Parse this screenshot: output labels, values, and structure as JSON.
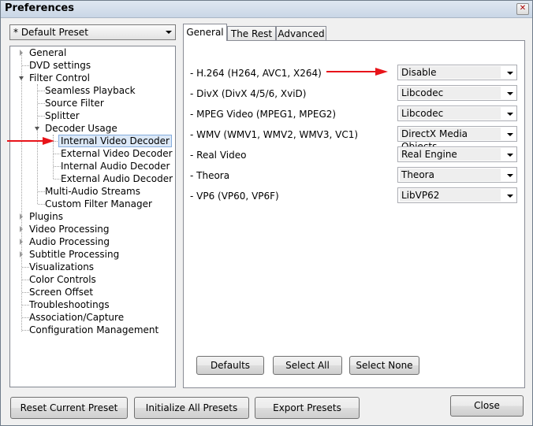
{
  "window": {
    "title": "Preferences",
    "close_glyph": "✕"
  },
  "preset": {
    "selected": "* Default Preset"
  },
  "tree": {
    "general": "General",
    "dvd": "DVD settings",
    "filter_control": "Filter Control",
    "seamless": "Seamless Playback",
    "source": "Source Filter",
    "splitter": "Splitter",
    "decoder_usage": "Decoder Usage",
    "int_video": "Internal Video Decoder",
    "ext_video": "External Video Decoder",
    "int_audio": "Internal Audio Decoder",
    "ext_audio": "External Audio Decoder",
    "multi_audio": "Multi-Audio Streams",
    "custom_filter": "Custom Filter Manager",
    "plugins": "Plugins",
    "video_proc": "Video Processing",
    "audio_proc": "Audio Processing",
    "subtitle_proc": "Subtitle Processing",
    "visualizations": "Visualizations",
    "color_controls": "Color Controls",
    "screen_offset": "Screen Offset",
    "troubleshootings": "Troubleshootings",
    "association": "Association/Capture",
    "config_mgmt": "Configuration Management"
  },
  "tabs": {
    "general": "General",
    "rest": "The Rest",
    "advanced": "Advanced"
  },
  "codecs": {
    "h264": {
      "label": "- H.264 (H264, AVC1, X264)",
      "value": "Disable"
    },
    "divx": {
      "label": "- DivX (DivX 4/5/6, XviD)",
      "value": "Libcodec"
    },
    "mpeg": {
      "label": "- MPEG Video (MPEG1, MPEG2)",
      "value": "Libcodec"
    },
    "wmv": {
      "label": "- WMV (WMV1, WMV2, WMV3, VC1)",
      "value": "DirectX Media Objects"
    },
    "real": {
      "label": "- Real Video",
      "value": "Real Engine"
    },
    "theora": {
      "label": "- Theora",
      "value": "Theora"
    },
    "vp6": {
      "label": "- VP6 (VP60, VP6F)",
      "value": "LibVP62"
    }
  },
  "panel_buttons": {
    "defaults": "Defaults",
    "select_all": "Select All",
    "select_none": "Select None"
  },
  "bottom_buttons": {
    "reset": "Reset Current Preset",
    "initialize": "Initialize All Presets",
    "export": "Export Presets",
    "close": "Close"
  },
  "colors": {
    "annotation_arrow": "#e8141a",
    "selection_highlight": "#dbe8f7"
  }
}
